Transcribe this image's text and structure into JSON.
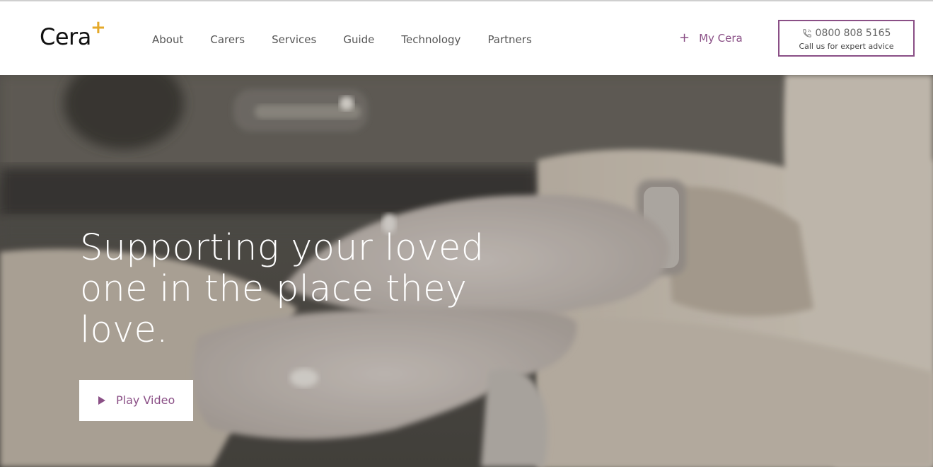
{
  "colors": {
    "accent_purple": "#8a4f86",
    "logo_plus": "#e5a92a",
    "nav_text": "#555555"
  },
  "brand": {
    "logo_text": "Cera",
    "logo_plus": "+"
  },
  "nav": {
    "items": [
      {
        "label": "About"
      },
      {
        "label": "Carers"
      },
      {
        "label": "Services"
      },
      {
        "label": "Guide"
      },
      {
        "label": "Technology"
      },
      {
        "label": "Partners"
      }
    ]
  },
  "account": {
    "icon": "plus-icon",
    "label": "My Cera"
  },
  "contact": {
    "icon": "phone-icon",
    "phone": "0800 808 5165",
    "subtitle": "Call us for expert advice"
  },
  "hero": {
    "headline": "Supporting your loved\none in the place they\nlove.",
    "play_icon": "play-icon",
    "play_label": "Play Video"
  }
}
